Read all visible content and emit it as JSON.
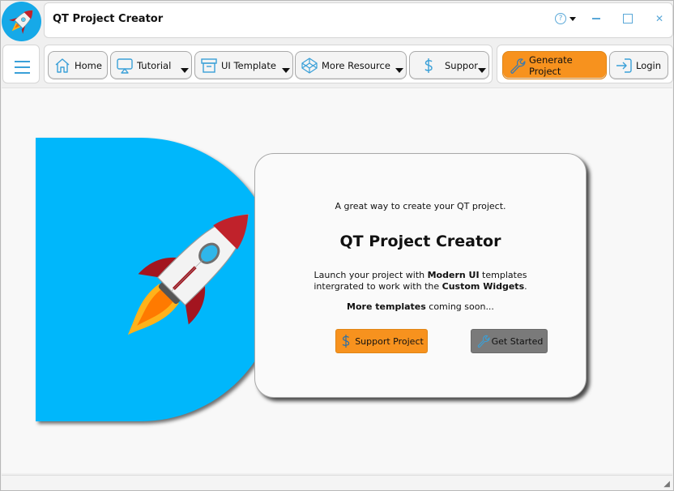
{
  "window": {
    "title": "QT Project Creator",
    "controls": {
      "help": "?",
      "minimize": "—",
      "maximize": "☐",
      "close": "✕"
    }
  },
  "toolbar": {
    "items": [
      {
        "label": "Home",
        "icon": "home-icon",
        "dropdown": false
      },
      {
        "label": "Tutorial",
        "icon": "presentation-icon",
        "dropdown": true
      },
      {
        "label": "UI Template",
        "icon": "archive-box-icon",
        "dropdown": true
      },
      {
        "label": "More Resource",
        "icon": "codepen-icon",
        "dropdown": true
      },
      {
        "label": "Suppor",
        "icon": "dollar-icon",
        "dropdown": true
      }
    ],
    "generate_label": "Generate Project",
    "login_label": "Login"
  },
  "hero": {
    "tagline": "A great way to create your QT project.",
    "title": "QT Project Creator",
    "desc_1_pre": "Launch your project with ",
    "desc_1_bold": "Modern UI",
    "desc_1_post": " templates",
    "desc_2_pre": "intergrated to work with the ",
    "desc_2_bold": "Custom Widgets",
    "desc_2_post": ".",
    "soon_bold": "More templates",
    "soon_post": " coming soon...",
    "support_label": "Support Project",
    "start_label": "Get Started"
  },
  "colors": {
    "accent_blue": "#00b7fb",
    "orange": "#f7921e",
    "gray_button": "#7a7a7a",
    "icon_blue": "#3aa0d8"
  }
}
